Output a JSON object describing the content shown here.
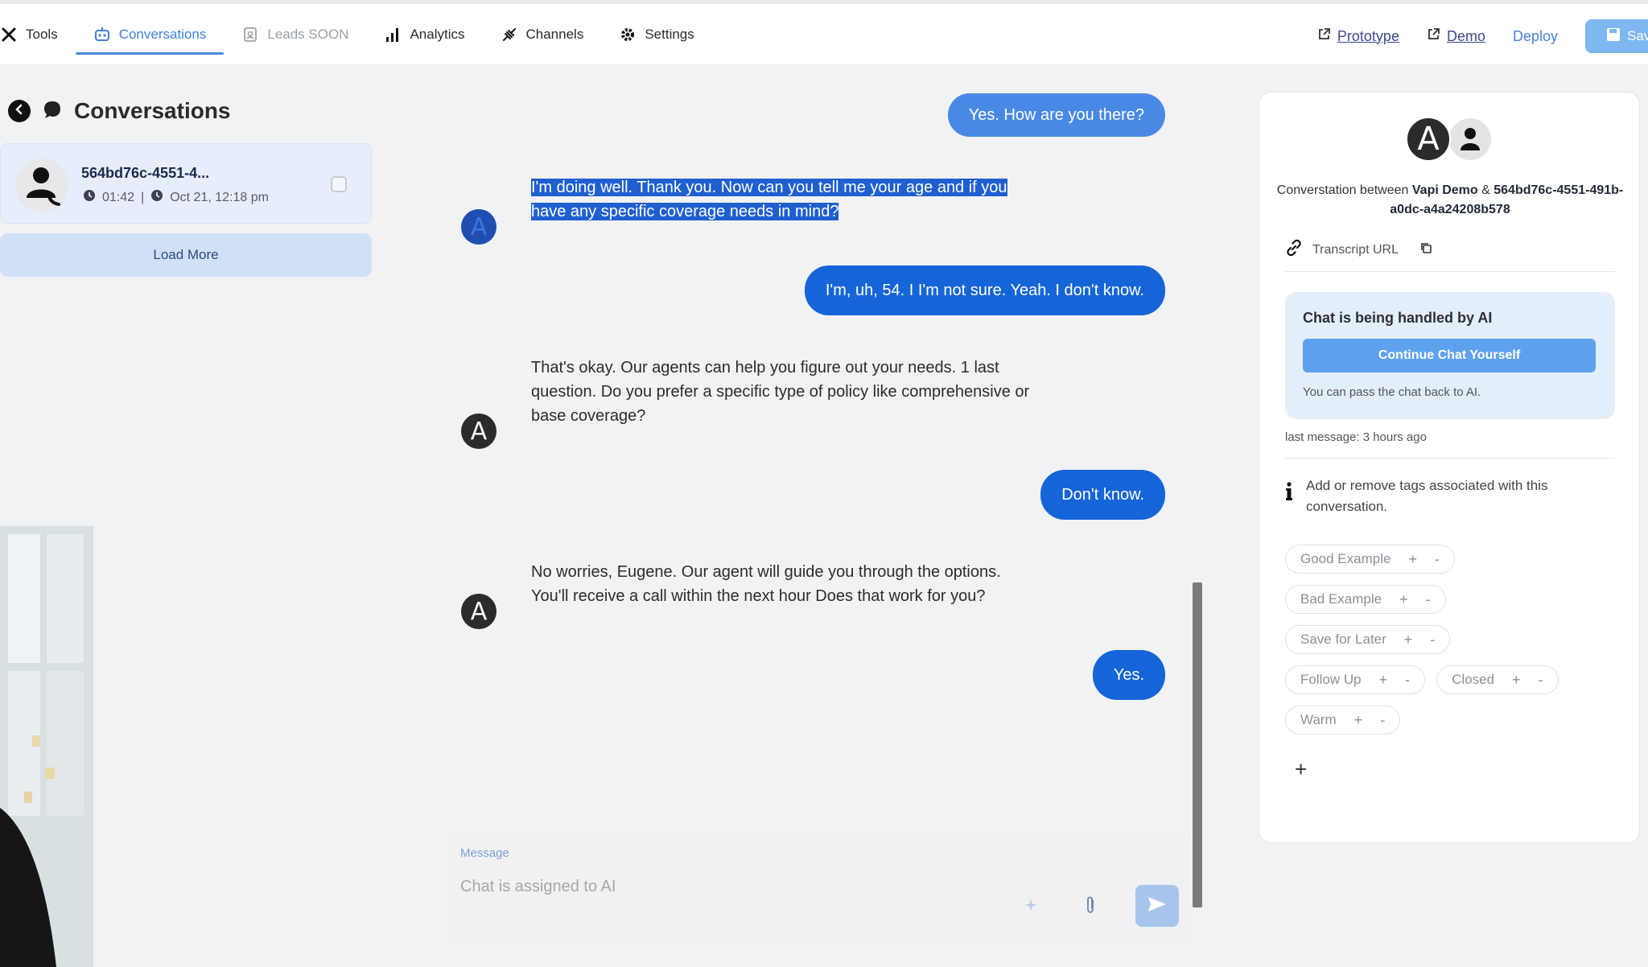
{
  "nav": {
    "items": [
      {
        "label": "Tools",
        "icon": "tools-icon"
      },
      {
        "label": "Conversations",
        "icon": "robot-icon",
        "active": true
      },
      {
        "label": "Leads SOON",
        "icon": "badge-icon",
        "dim": true
      },
      {
        "label": "Analytics",
        "icon": "bar-chart-icon"
      },
      {
        "label": "Channels",
        "icon": "plug-icon"
      },
      {
        "label": "Settings",
        "icon": "gear-icon"
      }
    ],
    "prototype_label": "Prototype",
    "demo_label": "Demo",
    "deploy_label": "Deploy",
    "save_label": "Sav"
  },
  "left": {
    "title": "Conversations",
    "conversation": {
      "id": "564bd76c-4551-4...",
      "duration": "01:42",
      "separator": "|",
      "date": "Oct 21, 12:18 pm"
    },
    "load_more": "Load More"
  },
  "chat": {
    "messages": [
      {
        "role": "user",
        "text": "Yes. How are you there?"
      },
      {
        "role": "bot",
        "text": "I'm doing well. Thank you. Now can you tell me your age and if you have any specific coverage needs in mind?",
        "line1": "I'm doing well. Thank you. Now can you tell me your age and if you",
        "line2": "have any specific coverage needs in mind?"
      },
      {
        "role": "user",
        "text": "I'm, uh, 54. I I'm not sure. Yeah. I don't know."
      },
      {
        "role": "bot",
        "text": "That's okay. Our agents can help you figure out your needs. 1 last question. Do you prefer a specific type of policy like comprehensive or base coverage?"
      },
      {
        "role": "user",
        "text": "Don't know."
      },
      {
        "role": "bot",
        "text": "No worries, Eugene. Our agent will guide you through the options. You'll receive a call within the next hour Does that work for you?"
      },
      {
        "role": "user",
        "text": "Yes."
      }
    ],
    "bot_avatar_letter": "A"
  },
  "composer": {
    "label": "Message",
    "placeholder": "Chat is assigned to AI"
  },
  "right": {
    "avatar_letter": "A",
    "between_prefix": "Converstation between ",
    "agent_name": "Vapi Demo",
    "amp": " & ",
    "conversation_id": "564bd76c-4551-491b-a0dc-a4a24208b578",
    "transcript_label": "Transcript URL",
    "ai_box": {
      "title": "Chat is being handled by AI",
      "button": "Continue Chat Yourself",
      "note": "You can pass the chat back to AI."
    },
    "last_message": "last message: 3 hours ago",
    "tags_info": "Add or remove tags associated with this conversation.",
    "tags": [
      [
        "Good Example"
      ],
      [
        "Bad Example"
      ],
      [
        "Save for Later"
      ],
      [
        "Follow Up",
        "Closed"
      ],
      [
        "Warm"
      ]
    ],
    "plus": "+",
    "minus": "-",
    "add_tag": "+"
  },
  "colors": {
    "accent": "#1565d8",
    "nav_active": "#3f7fd9",
    "ai_button": "#5ea2ee"
  }
}
